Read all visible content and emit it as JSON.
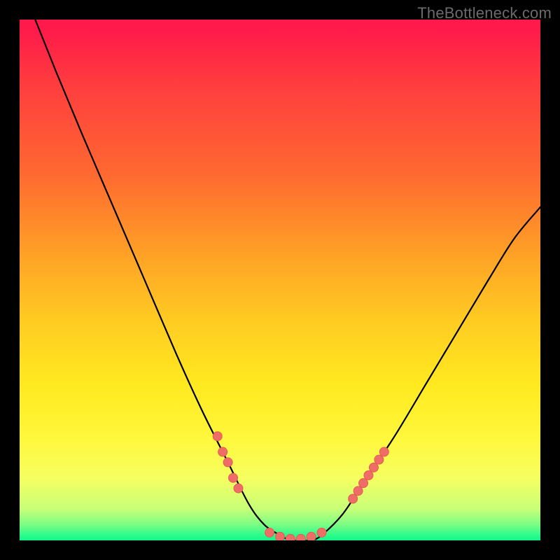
{
  "watermark": {
    "text": "TheBottleneck.com"
  },
  "colors": {
    "page_bg": "#000000",
    "curve": "#000000",
    "marker_fill": "#ee6e67",
    "marker_stroke": "#e55b54",
    "gradient_top": "#ff1a4b",
    "gradient_bottom": "#14f58a"
  },
  "chart_data": {
    "type": "line",
    "title": "",
    "xlabel": "",
    "ylabel": "",
    "xlim": [
      0,
      100
    ],
    "ylim": [
      0,
      100
    ],
    "grid": false,
    "legend": false,
    "series": [
      {
        "name": "curve",
        "x": [
          0,
          3,
          7,
          12,
          18,
          24,
          30,
          35,
          40,
          44,
          47,
          50,
          52,
          54,
          56,
          58,
          62,
          66,
          72,
          78,
          84,
          90,
          95,
          100
        ],
        "values": [
          107,
          100,
          90,
          78,
          64,
          50,
          36,
          25,
          15,
          7,
          3,
          1,
          0,
          0,
          0,
          1,
          5,
          11,
          20,
          30,
          40,
          50,
          58,
          64
        ]
      }
    ],
    "markers": {
      "name": "coral-dots",
      "clusters": [
        {
          "x": [
            38,
            39,
            40,
            41,
            42
          ],
          "y": [
            20,
            17,
            15,
            12,
            10
          ]
        },
        {
          "x": [
            48,
            50,
            52,
            54,
            56,
            58
          ],
          "y": [
            1.5,
            0.7,
            0.3,
            0.3,
            0.7,
            1.5
          ]
        },
        {
          "x": [
            64,
            65,
            66,
            67,
            68,
            69,
            70
          ],
          "y": [
            8,
            9.5,
            11,
            12.5,
            14,
            15.5,
            17
          ]
        }
      ]
    }
  }
}
